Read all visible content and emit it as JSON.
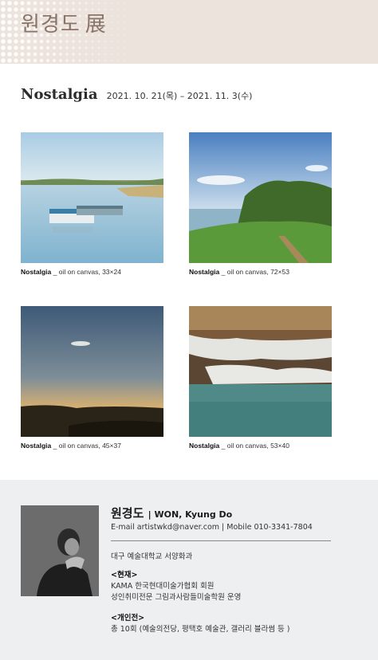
{
  "header": {
    "title": "원경도",
    "title_han": "展"
  },
  "exhibition": {
    "title": "Nostalgia",
    "dates": "2021. 10. 21(목) – 2021. 11. 3(수)"
  },
  "artworks": [
    {
      "title": "Nostalgia",
      "detail": "_ oil on canvas, 33×24"
    },
    {
      "title": "Nostalgia",
      "detail": "_ oil on canvas, 72×53"
    },
    {
      "title": "Nostalgia",
      "detail": "_ oil on canvas, 45×37"
    },
    {
      "title": "Nostalgia",
      "detail": "_ oil on canvas, 53×40"
    }
  ],
  "artist": {
    "name_ko": "원경도",
    "name_en": "| WON, Kyung Do",
    "contact": "E-mail artistwkd@naver.com | Mobile 010-3341-7804",
    "education": "대구 예술대학교 서양화과",
    "current_heading": "<현재>",
    "current_items": [
      "KAMA 한국현대미술가협회 회원",
      "성인취미전문 그림과사람들미술학원 운영"
    ],
    "solo_heading": "<개인전>",
    "solo_items": [
      "총 10회 (예술의전당, 평택호 예술관, 갤러리 블라썸 등 )"
    ]
  },
  "colors": {
    "header_bg": "#ece3dd",
    "header_text": "#8a7468",
    "footer_bg": "#eeeff1"
  }
}
